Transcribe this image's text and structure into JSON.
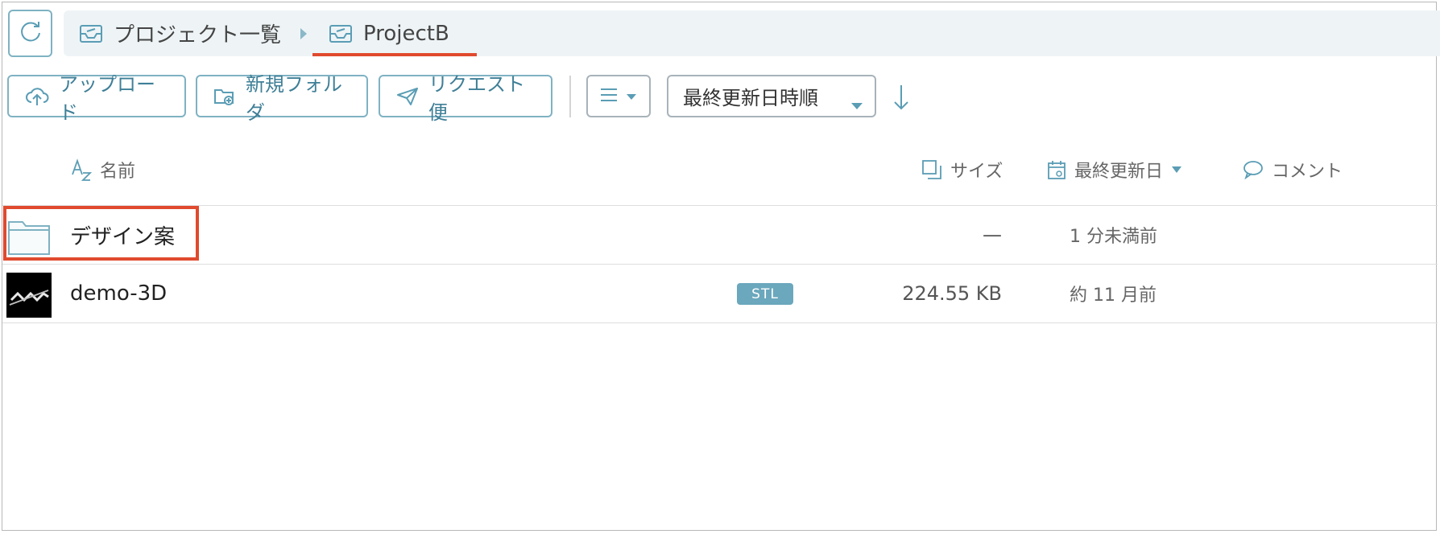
{
  "breadcrumb": {
    "items": [
      {
        "label": "プロジェクト一覧"
      },
      {
        "label": "ProjectB"
      }
    ]
  },
  "toolbar": {
    "upload_label": "アップロード",
    "new_folder_label": "新規フォルダ",
    "request_label": "リクエスト便",
    "sort_select_value": "最終更新日時順"
  },
  "table": {
    "columns": {
      "name": "名前",
      "size": "サイズ",
      "modified": "最終更新日",
      "comment": "コメント"
    },
    "rows": [
      {
        "name": "デザイン案",
        "type": "folder",
        "badge": "",
        "size": "—",
        "modified": "1 分未満前"
      },
      {
        "name": "demo-3D",
        "type": "file",
        "badge": "STL",
        "size": "224.55 KB",
        "modified": "約 11 月前"
      }
    ]
  },
  "colors": {
    "accent": "#3f7f97",
    "border_accent": "#7fb2c3",
    "highlight": "#e04a2e",
    "badge_bg": "#6ba7bd"
  },
  "icons": [
    "refresh-icon",
    "project-icon",
    "chevron-right-icon",
    "upload-cloud-icon",
    "folder-add-icon",
    "paper-plane-icon",
    "list-icon",
    "caret-down-icon",
    "arrow-down-icon",
    "sort-alpha-icon",
    "size-icon",
    "calendar-icon",
    "comment-icon",
    "folder-icon"
  ]
}
